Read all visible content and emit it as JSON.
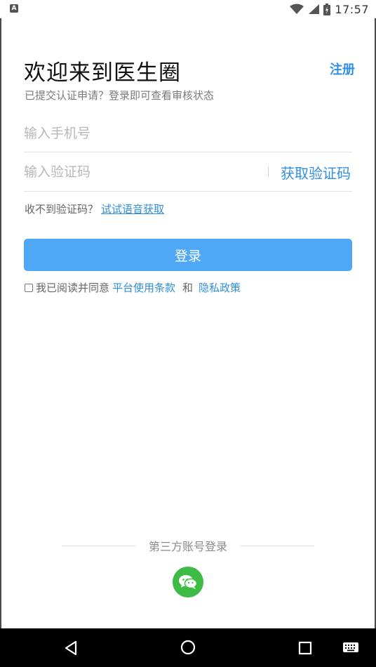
{
  "status_bar": {
    "app_icon_letter": "A",
    "time": "17:57"
  },
  "header": {
    "title": "欢迎来到医生圈",
    "register_label": "注册",
    "subtitle": "已提交认证申请？登录即可查看审核状态"
  },
  "form": {
    "phone_placeholder": "输入手机号",
    "code_placeholder": "输入验证码",
    "get_code_label": "获取验证码",
    "no_code_text": "收不到验证码？",
    "voice_link": "试试语音获取",
    "login_label": "登录"
  },
  "agreement": {
    "prefix": "我已阅读并同意",
    "terms_link": "平台使用条款",
    "and_text": "和",
    "privacy_link": "隐私政策"
  },
  "third_party": {
    "label": "第三方账号登录",
    "wechat_icon": "wechat-icon"
  },
  "colors": {
    "accent": "#2f8fe0",
    "login_button": "#4ea8f5",
    "wechat": "#3dbb44"
  },
  "nav_bar": {
    "icons": [
      "back-icon",
      "home-icon",
      "recent-apps-icon",
      "keyboard-icon"
    ]
  }
}
